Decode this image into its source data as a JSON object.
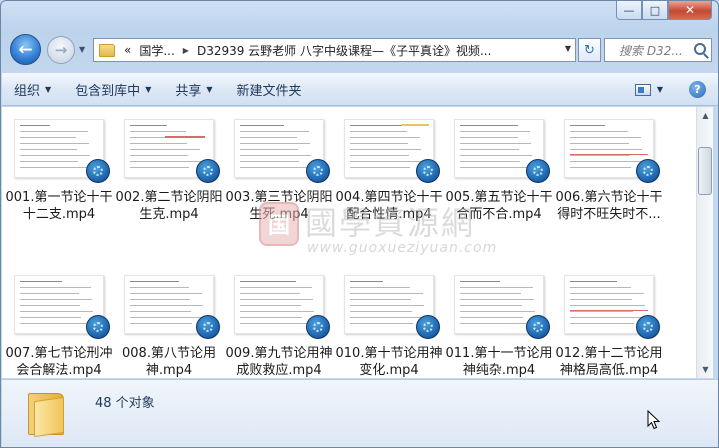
{
  "window": {
    "min_glyph": "—",
    "max_glyph": "□",
    "close_glyph": "✕"
  },
  "nav": {
    "back_glyph": "←",
    "forward_glyph": "→",
    "address_chevron": "«",
    "address_parts": [
      "国学...",
      "D32939 云野老师 八字中级课程—《子平真诠》视频..."
    ],
    "refresh_glyph": "↻",
    "search_placeholder": "搜索 D32..."
  },
  "toolbar": {
    "organize": "组织",
    "include_library": "包含到库中",
    "share": "共享",
    "new_folder": "新建文件夹",
    "help": "?"
  },
  "files": [
    {
      "label": "001.第一节论十干十二支.mp4"
    },
    {
      "label": "002.第二节论阴阳生克.mp4"
    },
    {
      "label": "003.第三节论阴阳生死.mp4"
    },
    {
      "label": "004.第四节论十干配合性情.mp4"
    },
    {
      "label": "005.第五节论十干合而不合.mp4"
    },
    {
      "label": "006.第六节论十干得时不旺失时不..."
    },
    {
      "label": "007.第七节论刑冲会合解法.mp4"
    },
    {
      "label": "008.第八节论用神.mp4"
    },
    {
      "label": "009.第九节论用神成败救应.mp4"
    },
    {
      "label": "010.第十节论用神变化.mp4"
    },
    {
      "label": "011.第十一节论用神纯杂.mp4"
    },
    {
      "label": "012.第十二节论用神格局高低.mp4"
    }
  ],
  "watermark": {
    "seal": "国",
    "title": "國學資源網",
    "url": "www.guoxueziyuan.com"
  },
  "status": {
    "count": "48 个对象"
  },
  "colors": {
    "accent": "#2f7bd1",
    "chrome": "#c6d9ee",
    "badge": "#1b5fa8"
  }
}
